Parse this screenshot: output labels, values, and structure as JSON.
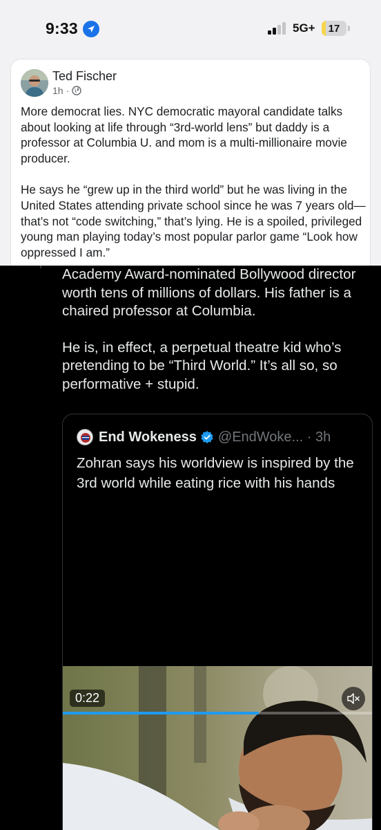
{
  "status_bar": {
    "time": "9:33",
    "network": "5G+",
    "battery": "17",
    "battery_level": 0.17,
    "signal_bars_active": 2,
    "signal_bars_total": 4
  },
  "post": {
    "author": "Ted Fischer",
    "time": "1h",
    "separator": "·",
    "privacy_icon": "globe-icon",
    "paragraphs": [
      "More democrat lies. NYC democratic mayoral candidate talks about looking at life through “3rd-world lens” but daddy is a professor at Columbia U. and mom is a multi-millionaire movie producer.",
      "He says he “grew up in the third world” but he was living in the United States attending private school since he was 7 years old—that’s not “code switching,” that’s lying. He is a spoiled, privileged young man playing today’s most popular parlor game “Look how oppressed I am.”"
    ]
  },
  "x_post": {
    "paragraphs": [
      "Academy Award-nominated Bollywood director worth tens of millions of dollars. His father is a chaired professor at Columbia.",
      "He is, in effect, a perpetual theatre kid who’s pretending to be “Third World.” It’s all so, so performative + stupid."
    ],
    "quote": {
      "name": "End Wokeness",
      "handle": "@EndWoke... · 3h",
      "text": "Zohran says his worldview is inspired by the 3rd world while eating rice with his hands",
      "video_time": "0:22",
      "video_progress": 0.63,
      "mute_icon": "speaker-muted-icon",
      "verified_icon": "verified-badge-icon"
    }
  },
  "colors": {
    "background": "#f2f2f4",
    "card": "#ffffff",
    "x_background": "#000000",
    "x_text": "#e7e9ea",
    "x_muted": "#71767b",
    "x_blue": "#1d9bf0",
    "battery_yellow": "#f7d54a"
  }
}
